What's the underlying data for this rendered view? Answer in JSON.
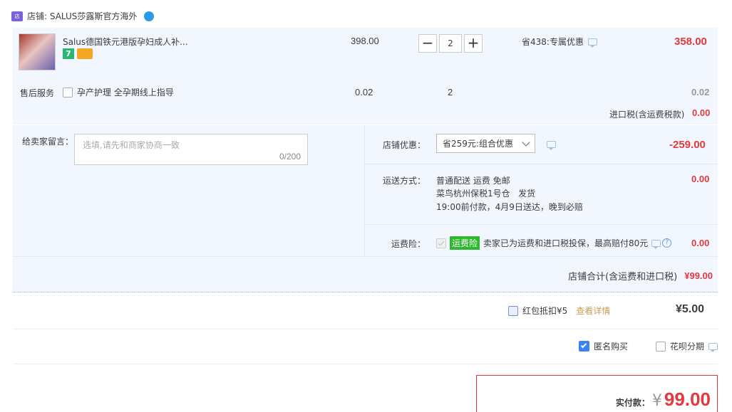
{
  "shop": {
    "label": "店铺: SALUS莎露斯官方海外"
  },
  "item": {
    "title": "Salus德国铁元港版孕妇成人补...",
    "price": "398.00",
    "quantity": "2",
    "promo": "省438:专属优惠",
    "subtotal": "358.00"
  },
  "service": {
    "label": "售后服务",
    "option": "孕产护理 全孕期线上指导",
    "price": "0.02",
    "quantity": "2",
    "subtotal": "0.02"
  },
  "import_tax": {
    "label": "进口税(含运费税款)",
    "value": "0.00"
  },
  "message": {
    "label": "给卖家留言：",
    "placeholder": "选填,请先和商家协商一致",
    "counter": "0/200"
  },
  "shop_discount": {
    "label": "店铺优惠：",
    "selected": "省259元:组合优惠",
    "value": "-259.00"
  },
  "shipping": {
    "label": "运送方式：",
    "line1": "普通配送 运费 免邮",
    "line2": "菜鸟杭州保税1号仓   发货",
    "line3": "19:00前付款，4月9日送达，晚到必赔",
    "value": "0.00"
  },
  "insurance": {
    "label": "运费险：",
    "badge": "运费险",
    "text": "卖家已为运费和进口税投保，最高赔付80元",
    "value": "0.00"
  },
  "shop_total": {
    "label": "店铺合计(含运费和进口税)",
    "value": "¥99.00"
  },
  "red_packet": {
    "label": "红包抵扣¥5",
    "link": "查看详情",
    "value": "¥5.00"
  },
  "anonymous": {
    "label": "匿名购买",
    "checked": true
  },
  "huabei": {
    "label": "花呗分期"
  },
  "payment": {
    "label": "实付款：",
    "currency": "¥",
    "value": "99.00"
  },
  "colors": {
    "accent_red": "#f40",
    "crimson": "#e4393c",
    "panel_bg": "#f2f7ff",
    "green": "#2eb82e",
    "checkbox_blue": "#3b82f6"
  }
}
